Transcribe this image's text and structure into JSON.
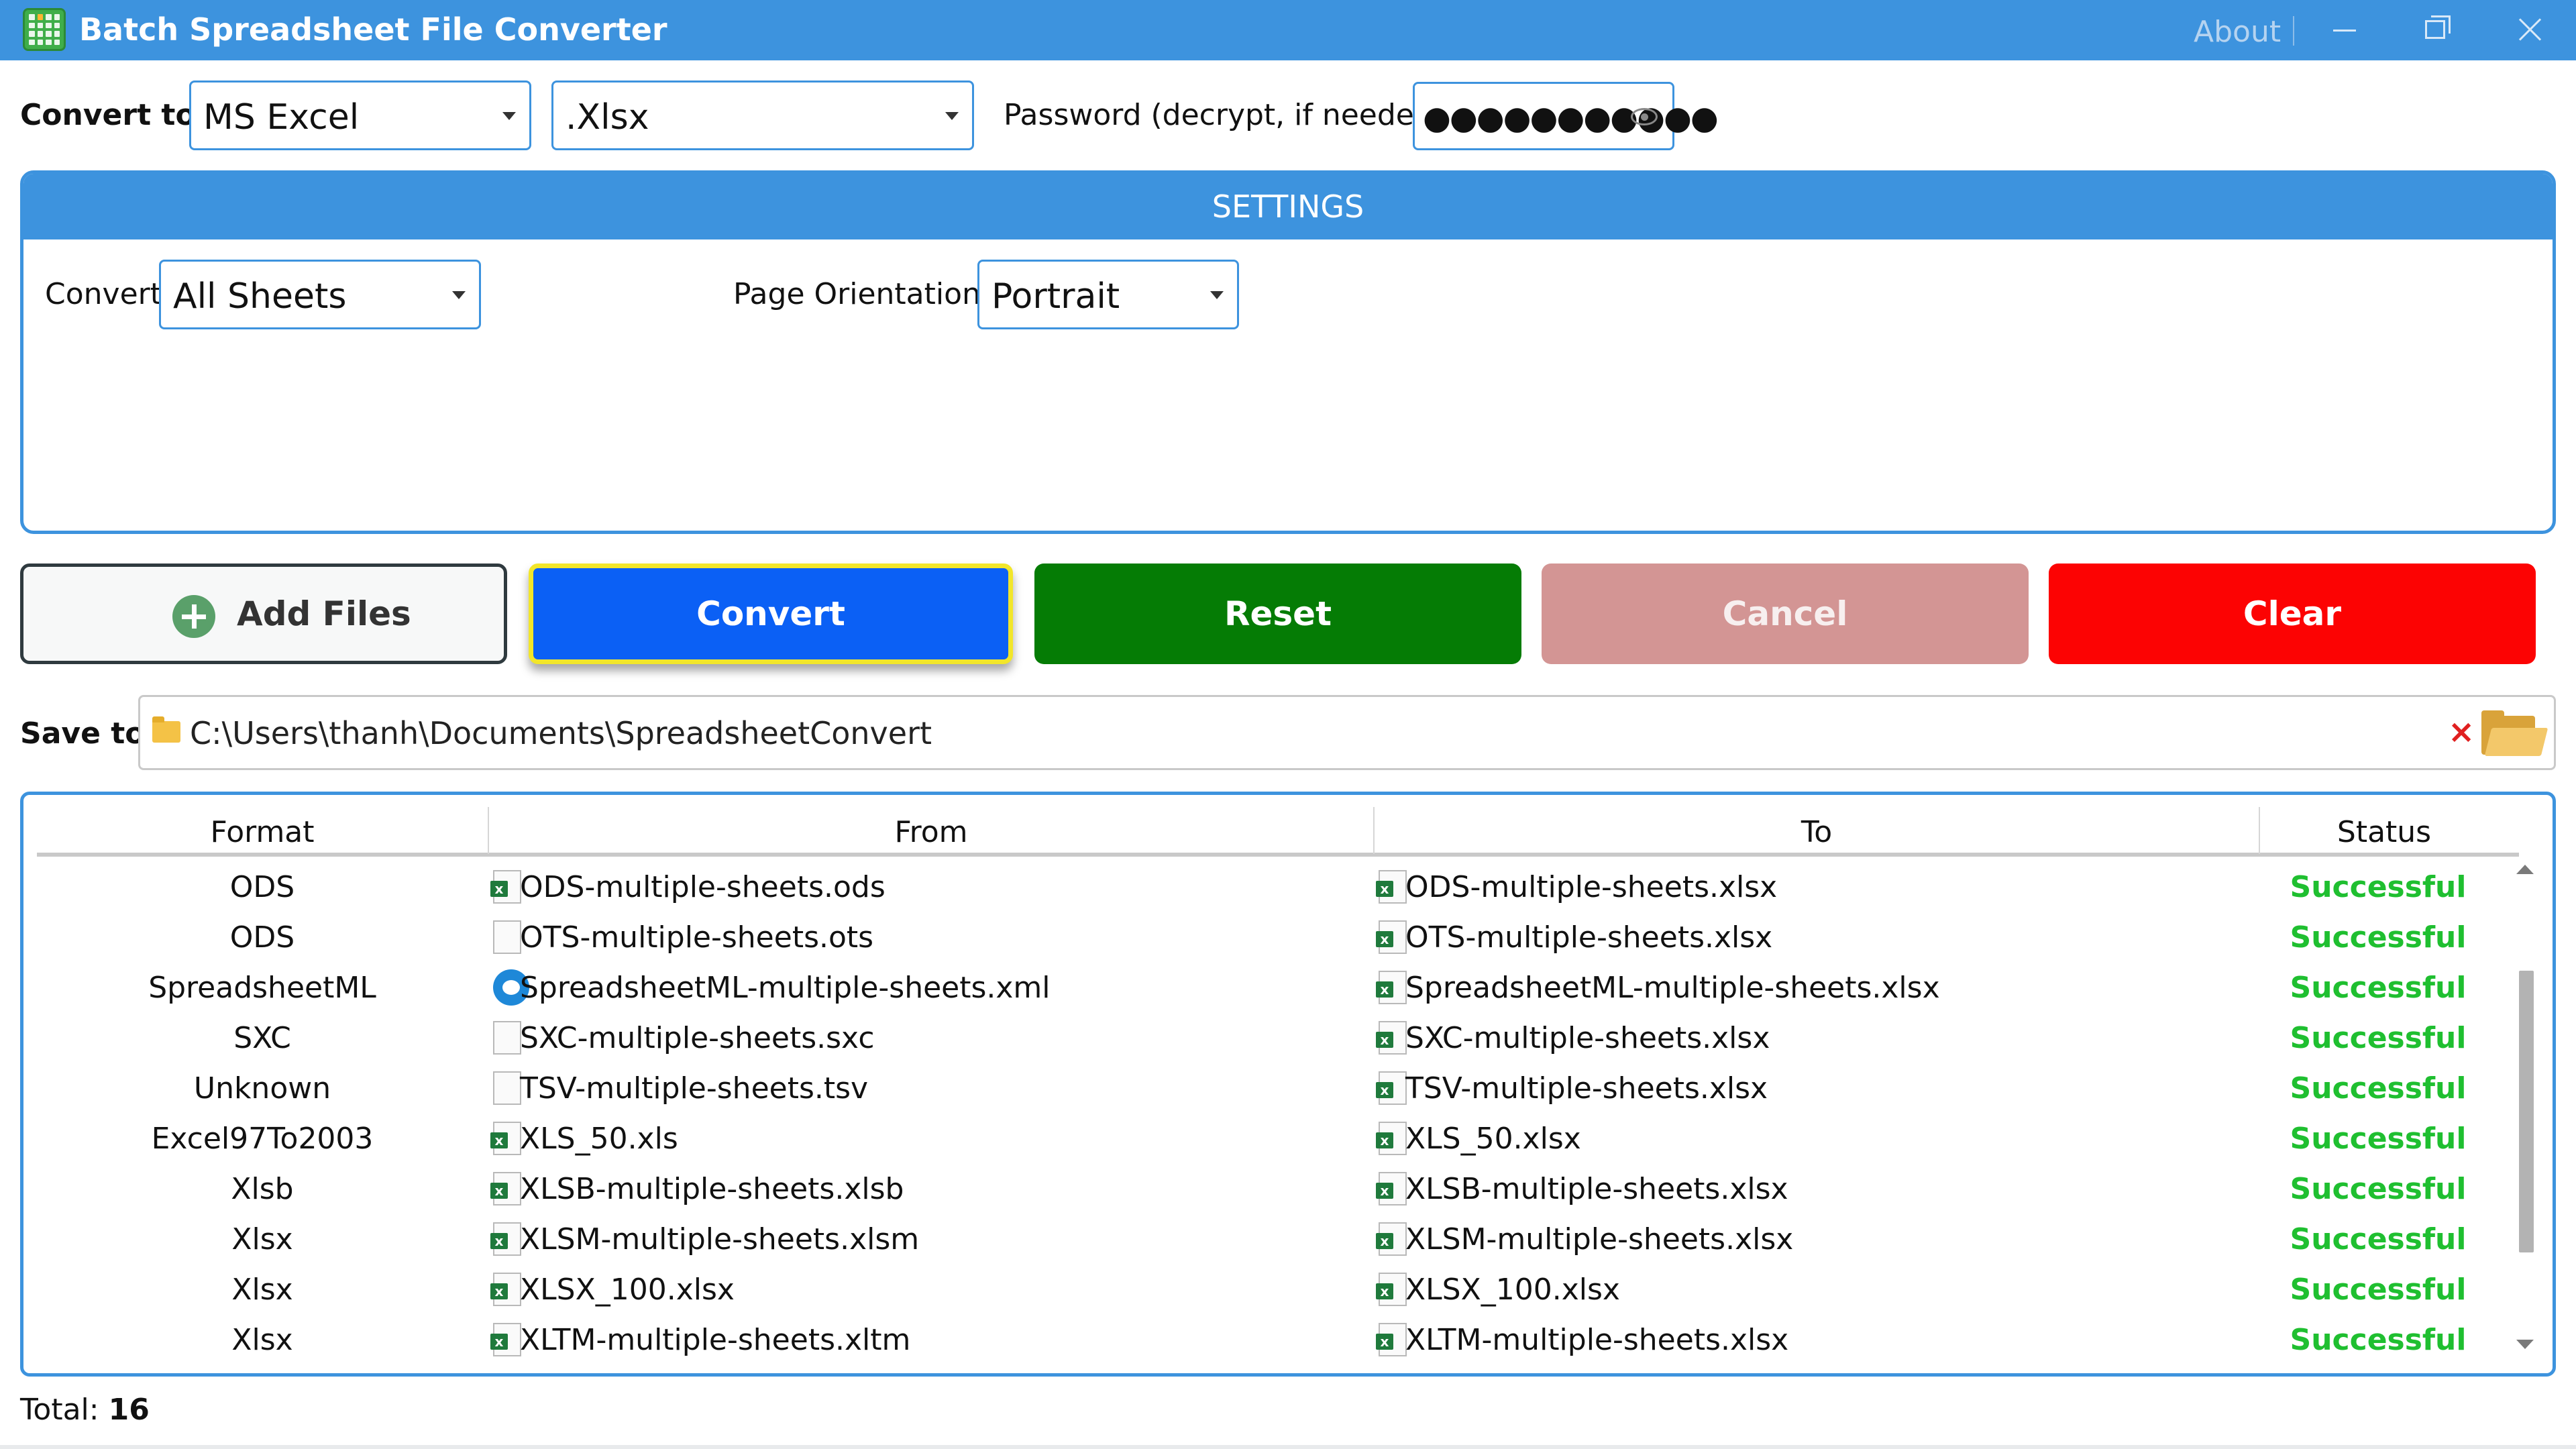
{
  "window": {
    "title": "Batch Spreadsheet File Converter",
    "about_label": "About"
  },
  "convert_to": {
    "label": "Convert to:",
    "format": "MS Excel",
    "extension": ".Xlsx"
  },
  "password": {
    "label": "Password (decrypt, if needed):",
    "masked_value": "●●●●●●●●●●●"
  },
  "settings": {
    "title": "SETTINGS",
    "convert_label": "Convert",
    "convert_value": "All Sheets",
    "orientation_label": "Page Orientation:",
    "orientation_value": "Portrait"
  },
  "actions": {
    "add_files": "Add Files",
    "convert": "Convert",
    "reset": "Reset",
    "cancel": "Cancel",
    "clear": "Clear"
  },
  "save_to": {
    "label": "Save to:",
    "path": "C:\\Users\\thanh\\Documents\\SpreadsheetConvert",
    "clear_glyph": "×"
  },
  "table": {
    "columns": [
      "Format",
      "From",
      "To",
      "Status"
    ],
    "rows": [
      {
        "format": "ODS",
        "from": "ODS-multiple-sheets.ods",
        "to": "ODS-multiple-sheets.xlsx",
        "status": "Successful",
        "from_icon": "excel-file-icon"
      },
      {
        "format": "ODS",
        "from": "OTS-multiple-sheets.ots",
        "to": "OTS-multiple-sheets.xlsx",
        "status": "Successful",
        "from_icon": "blank-file-icon"
      },
      {
        "format": "SpreadsheetML",
        "from": "SpreadsheetML-multiple-sheets.xml",
        "to": "SpreadsheetML-multiple-sheets.xlsx",
        "status": "Successful",
        "from_icon": "edge-browser-icon"
      },
      {
        "format": "SXC",
        "from": "SXC-multiple-sheets.sxc",
        "to": "SXC-multiple-sheets.xlsx",
        "status": "Successful",
        "from_icon": "blank-file-icon"
      },
      {
        "format": "Unknown",
        "from": "TSV-multiple-sheets.tsv",
        "to": "TSV-multiple-sheets.xlsx",
        "status": "Successful",
        "from_icon": "blank-file-icon"
      },
      {
        "format": "Excel97To2003",
        "from": "XLS_50.xls",
        "to": "XLS_50.xlsx",
        "status": "Successful",
        "from_icon": "excel-file-icon"
      },
      {
        "format": "Xlsb",
        "from": "XLSB-multiple-sheets.xlsb",
        "to": "XLSB-multiple-sheets.xlsx",
        "status": "Successful",
        "from_icon": "excel-file-icon"
      },
      {
        "format": "Xlsx",
        "from": "XLSM-multiple-sheets.xlsm",
        "to": "XLSM-multiple-sheets.xlsx",
        "status": "Successful",
        "from_icon": "excel-file-icon"
      },
      {
        "format": "Xlsx",
        "from": "XLSX_100.xlsx",
        "to": "XLSX_100.xlsx",
        "status": "Successful",
        "from_icon": "excel-file-icon"
      },
      {
        "format": "Xlsx",
        "from": "XLTM-multiple-sheets.xltm",
        "to": "XLTM-multiple-sheets.xlsx",
        "status": "Successful",
        "from_icon": "excel-file-icon"
      }
    ]
  },
  "footer": {
    "total_label": "Total:",
    "total_value": "16"
  },
  "colors": {
    "accent": "#3d93de",
    "convert": "#0b60f5",
    "reset": "#057c05",
    "cancel": "#d39594",
    "clear": "#fc0303",
    "success": "#1fbf30"
  }
}
